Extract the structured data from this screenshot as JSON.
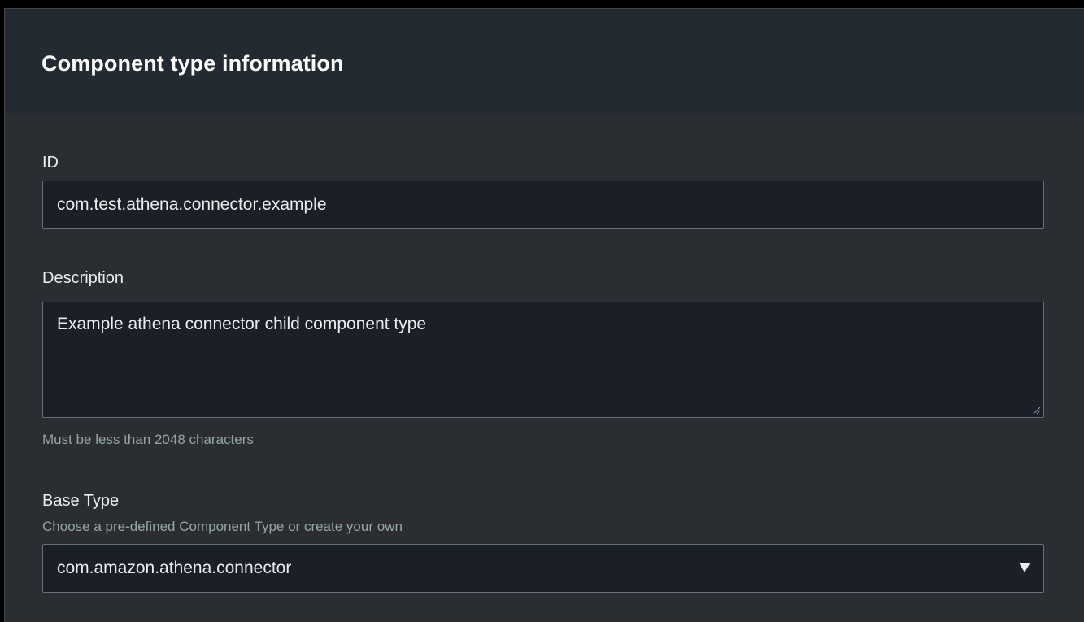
{
  "panel": {
    "title": "Component type information"
  },
  "fields": {
    "id": {
      "label": "ID",
      "value": "com.test.athena.connector.example"
    },
    "description": {
      "label": "Description",
      "value": "Example athena connector child component type",
      "hint": "Must be less than 2048 characters"
    },
    "base_type": {
      "label": "Base Type",
      "hint": "Choose a pre-defined Component Type or create your own",
      "selected": "com.amazon.athena.connector",
      "icon": "caret-down-icon"
    }
  }
}
